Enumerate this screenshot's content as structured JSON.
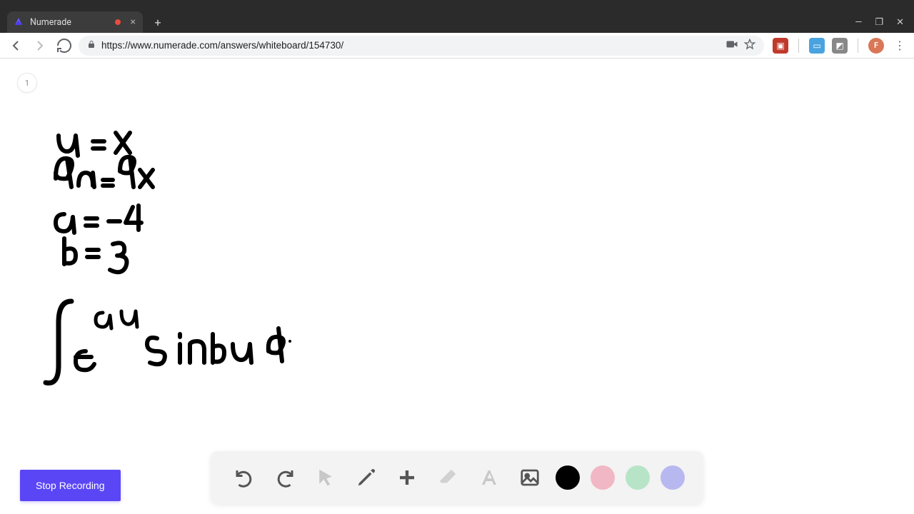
{
  "window": {
    "tab_title": "Numerade",
    "url": "https://www.numerade.com/answers/whiteboard/154730/"
  },
  "whiteboard": {
    "page_number": "1",
    "handwritten_lines": [
      "u = x",
      "du = dx",
      "a = -4",
      "b = 3",
      "∫ e^{au} sinbu d"
    ]
  },
  "controls": {
    "stop_recording_label": "Stop Recording"
  },
  "toolbar": {
    "tools": [
      "undo",
      "redo",
      "pointer",
      "pen",
      "add",
      "eraser",
      "text",
      "image"
    ],
    "colors": {
      "black": "#000000",
      "pink": "#f2b7c4",
      "green": "#b7e4c7",
      "purple": "#b8b8f0"
    },
    "active_color": "black"
  },
  "avatar": {
    "initial": "F"
  }
}
